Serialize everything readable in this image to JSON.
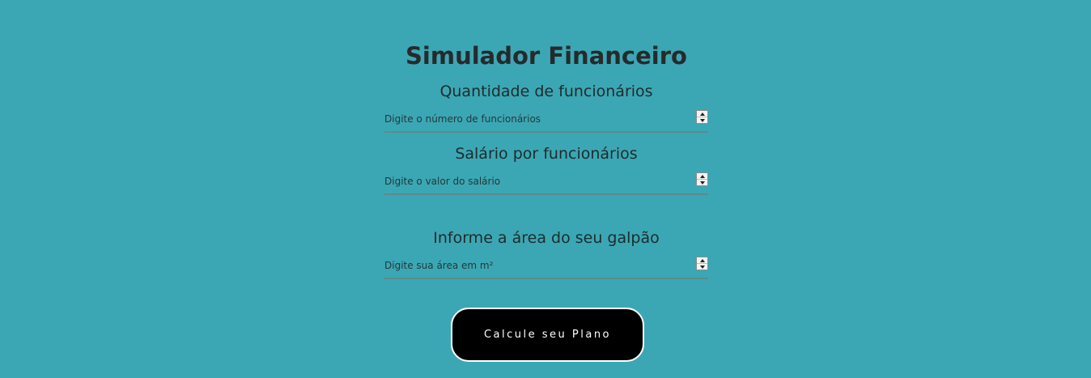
{
  "page": {
    "title": "Simulador Financeiro"
  },
  "form": {
    "employees": {
      "label": "Quantidade de funcionários",
      "value": "",
      "placeholder": "Digite o número de funcionários"
    },
    "salary": {
      "label": "Salário por funcionários",
      "value": "",
      "placeholder": "Digite o valor do salário"
    },
    "area": {
      "label": "Informe a área do seu galpão",
      "value": "",
      "placeholder": "Digite sua área em m²"
    },
    "submit_label": "Calcule seu Plano"
  },
  "icons": {
    "spinner_up": "chevron-up-icon",
    "spinner_down": "chevron-down-icon"
  },
  "colors": {
    "background": "#3ba7b4",
    "button_background": "#000000",
    "button_text": "#ffffff",
    "button_border": "#ffffff",
    "text": "#1f2b2d"
  }
}
